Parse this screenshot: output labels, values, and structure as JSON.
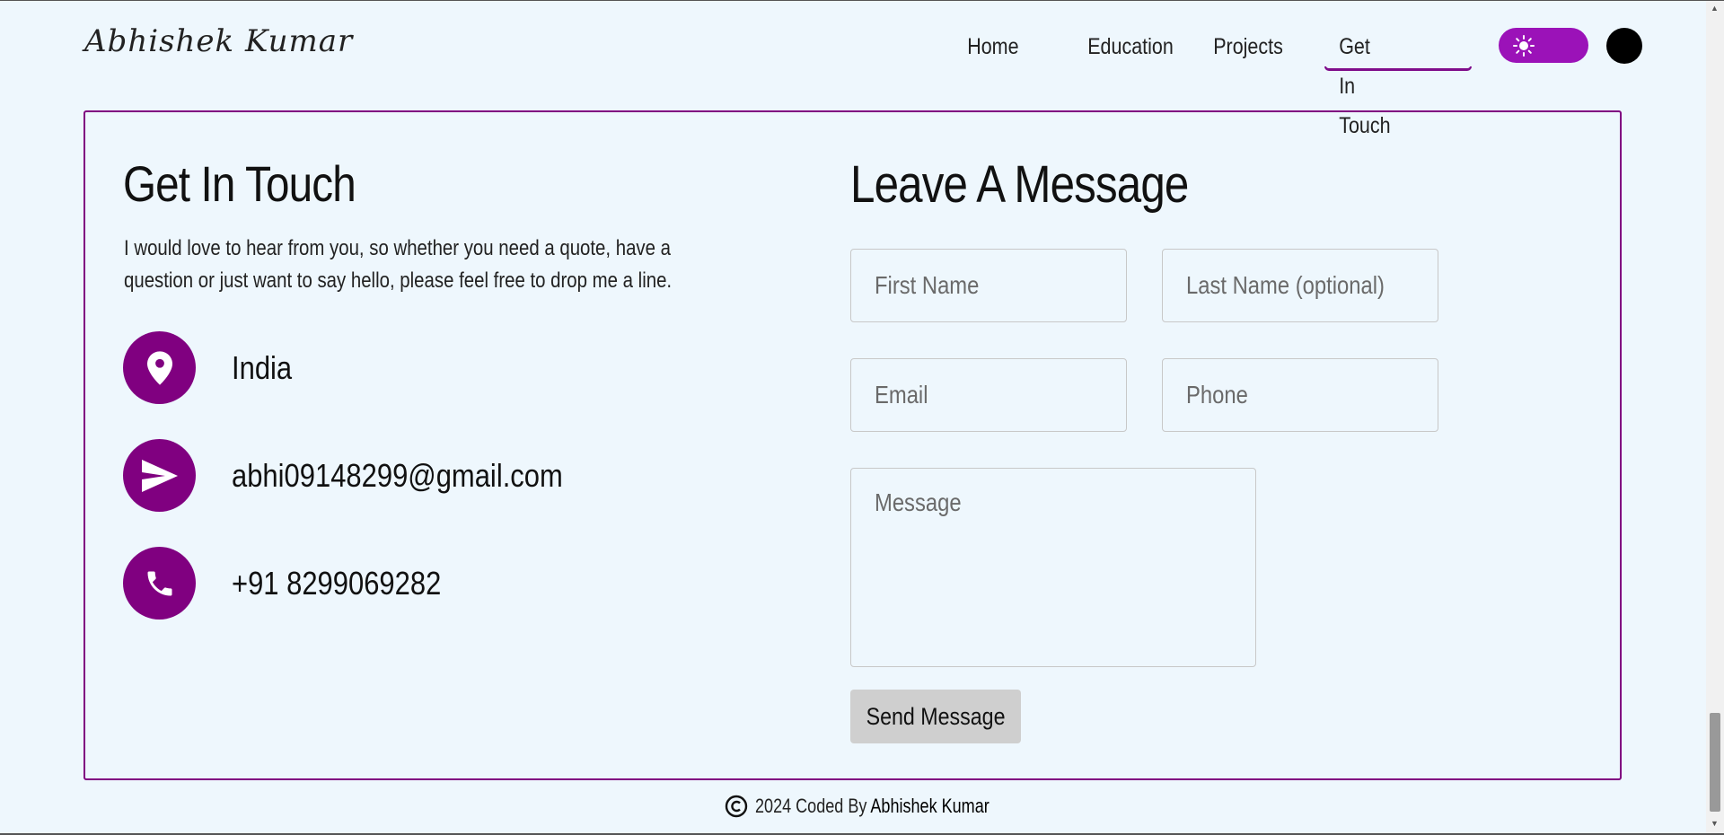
{
  "header": {
    "logo": "Abhishek Kumar",
    "nav": [
      "Home",
      "Education",
      "Projects",
      "Get In Touch"
    ],
    "active_nav": "Get In Touch"
  },
  "contact": {
    "title": "Get In Touch",
    "intro": "I would love to hear from you, so whether you need a quote, have a question or just want to say hello, please feel free to drop me a line.",
    "location": "India",
    "email": "abhi09148299@gmail.com",
    "phone": "+91 8299069282"
  },
  "form": {
    "title": "Leave A Message",
    "first_name_placeholder": "First Name",
    "last_name_placeholder": "Last Name (optional)",
    "email_placeholder": "Email",
    "phone_placeholder": "Phone",
    "message_placeholder": "Message",
    "submit_label": "Send Message"
  },
  "footer": {
    "prefix": "2024 Coded By",
    "author": "Abhishek Kumar"
  },
  "colors": {
    "accent": "#800080",
    "toggle": "#9b12b8",
    "background": "#eef7fd"
  }
}
